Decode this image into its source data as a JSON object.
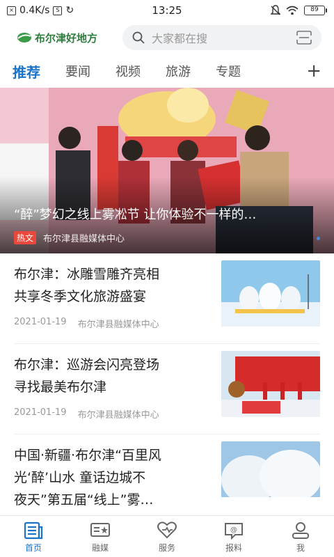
{
  "status_bar": {
    "speed": "0.4K/s",
    "time": "13:25",
    "battery": "89"
  },
  "header": {
    "logo_text": "布尔津好地方",
    "search_placeholder": "大家都在搜"
  },
  "tabs": [
    {
      "label": "推荐",
      "active": true
    },
    {
      "label": "要闻"
    },
    {
      "label": "视频"
    },
    {
      "label": "旅游"
    },
    {
      "label": "专题"
    }
  ],
  "banner": {
    "title": "“醉”梦幻之线上雾凇节 让你体验不一样的…",
    "tag": "热文",
    "source": "布尔津县融媒体中心"
  },
  "news": [
    {
      "title_line1": "布尔津：冰雕雪雕齐亮相",
      "title_line2": "共享冬季文化旅游盛宴",
      "date": "2021-01-19",
      "source": "布尔津县融媒体中心"
    },
    {
      "title_line1": "布尔津：巡游会闪亮登场",
      "title_line2": "寻找最美布尔津",
      "date": "2021-01-19",
      "source": "布尔津县融媒体中心"
    },
    {
      "title_line1": "中国·新疆·布尔津“百里风",
      "title_line2": "光‘醉’山水 童话边城不",
      "title_line3": "夜天”第五届“线上”雾…"
    }
  ],
  "bottom_nav": [
    {
      "label": "首页",
      "icon": "news-icon",
      "active": true
    },
    {
      "label": "融媒",
      "icon": "media-icon"
    },
    {
      "label": "服务",
      "icon": "service-icon"
    },
    {
      "label": "报料",
      "icon": "report-icon"
    },
    {
      "label": "我",
      "icon": "user-icon"
    }
  ],
  "colors": {
    "accent": "#1a73c8",
    "logo": "#2f7d3e",
    "hot_tag": "#e8493c"
  }
}
